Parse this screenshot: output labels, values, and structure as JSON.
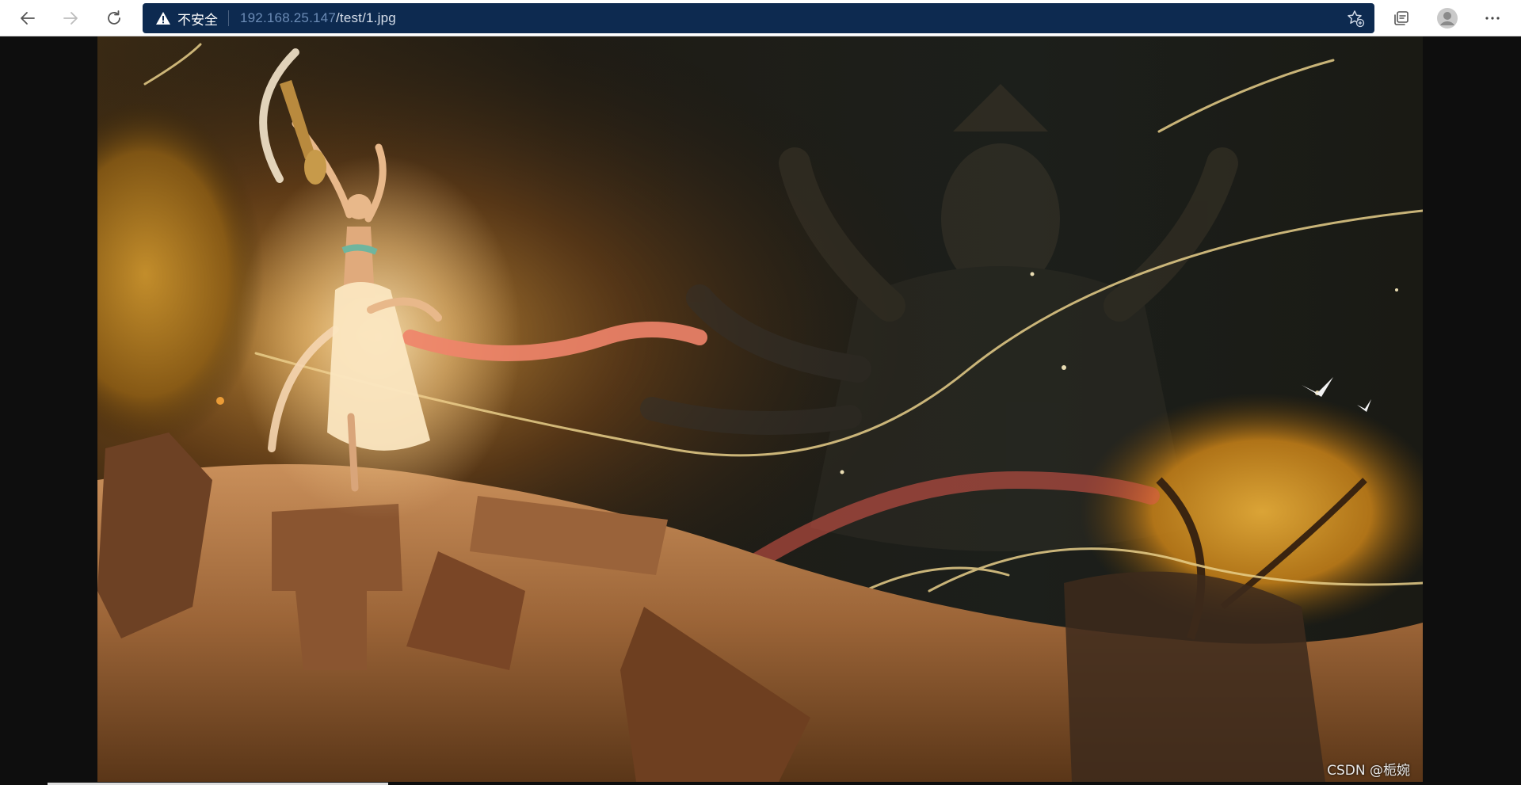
{
  "browser": {
    "security_label": "不安全",
    "url_host": "192.168.25.147",
    "url_path": "/test/1.jpg"
  },
  "icons": {
    "back": "arrow-left-icon",
    "forward": "arrow-right-icon",
    "refresh": "refresh-icon",
    "warning": "warning-triangle-icon",
    "favorites_add": "star-plus-icon",
    "collections": "collections-icon",
    "profile": "profile-avatar-icon",
    "menu": "more-horizontal-icon"
  },
  "colors": {
    "address_bar_bg": "#0d2a50",
    "page_bg": "#0e0e0e",
    "toolbar_bg": "#ffffff"
  },
  "watermark": "CSDN @栀婉"
}
